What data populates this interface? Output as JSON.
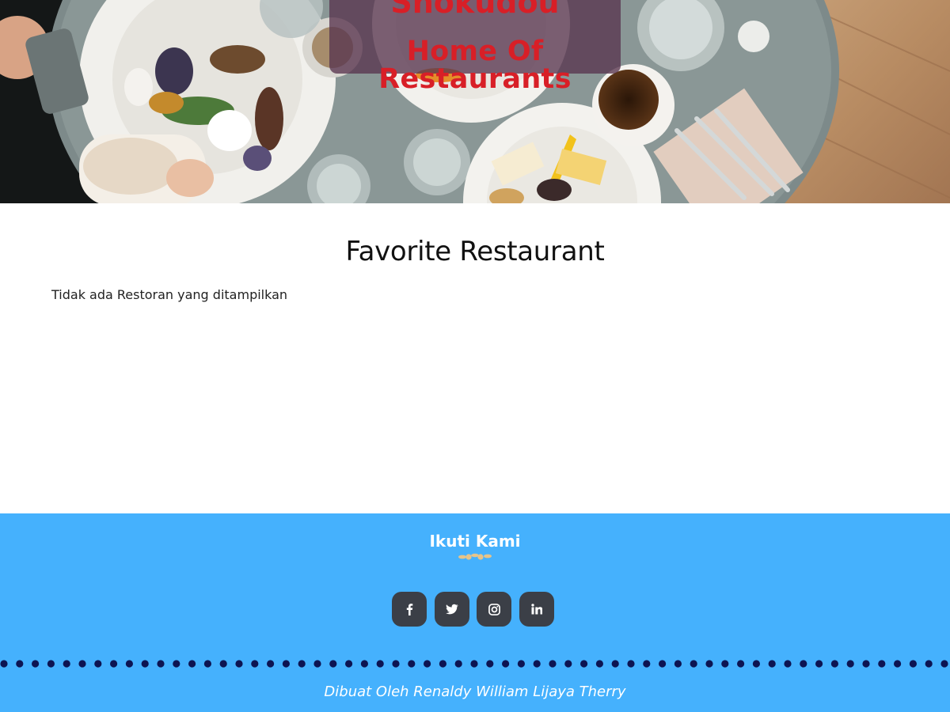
{
  "hero": {
    "title": "Shokudou",
    "subtitle": "Home Of Restaurants"
  },
  "main": {
    "title": "Favorite Restaurant",
    "empty_message": "Tidak ada Restoran yang ditampilkan"
  },
  "footer": {
    "follow_title": "Ikuti Kami",
    "social": [
      {
        "name": "facebook",
        "icon": "facebook-icon"
      },
      {
        "name": "twitter",
        "icon": "twitter-icon"
      },
      {
        "name": "instagram",
        "icon": "instagram-icon"
      },
      {
        "name": "linkedin",
        "icon": "linkedin-icon"
      }
    ],
    "credit": "Dibuat Oleh Renaldy William Lijaya Therry"
  },
  "colors": {
    "title_red": "#d81f27",
    "title_box": "#58344e",
    "footer_bg": "#45b1fd",
    "social_btn": "#3b3f47",
    "dot_navy": "#0d1452",
    "ornament": "#e6c48a"
  }
}
